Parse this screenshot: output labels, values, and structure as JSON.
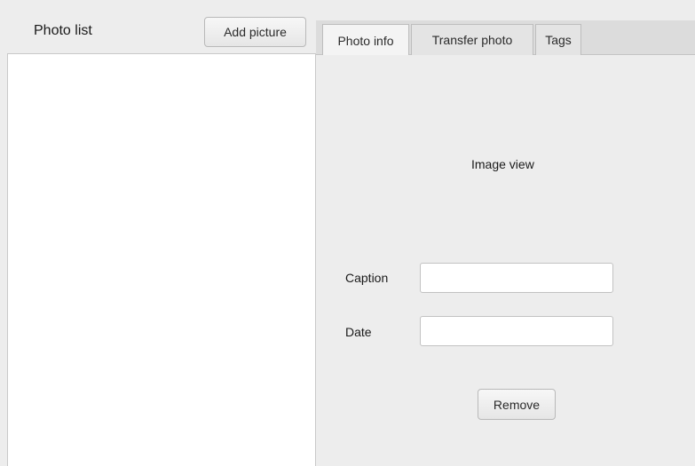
{
  "left_pane": {
    "title": "Photo list",
    "add_button_label": "Add picture"
  },
  "tabs": [
    {
      "label": "Photo info",
      "active": true
    },
    {
      "label": "Transfer photo",
      "active": false
    },
    {
      "label": "Tags",
      "active": false
    }
  ],
  "photo_info": {
    "image_view_text": "Image view",
    "caption_label": "Caption",
    "caption_value": "",
    "date_label": "Date",
    "date_value": "",
    "remove_button_label": "Remove"
  }
}
